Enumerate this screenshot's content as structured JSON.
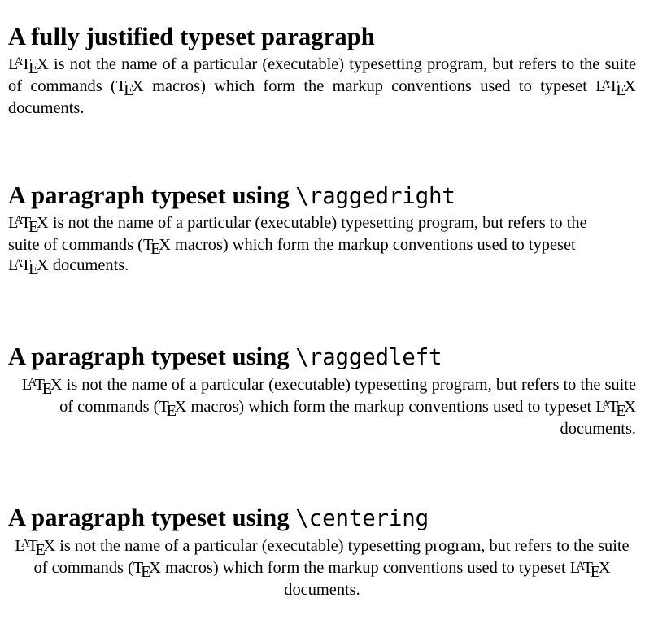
{
  "document": {
    "background_color": "#ffffff",
    "text_color": "#000000",
    "sections": [
      {
        "id": "fully-justified",
        "heading_text": "A fully justified typeset paragraph",
        "heading_plain_part": "A fully justified typeset paragraph",
        "heading_macro_part": "",
        "alignment": "justify",
        "paragraph_segments": {
          "s1": " is not the name of a particular (executable) typesetting program, but refers to the suite of commands (",
          "s2": " macros) which form the markup conventions used to typeset ",
          "s3": " documents."
        }
      },
      {
        "id": "raggedright",
        "heading_text": "A paragraph typeset using \\raggedright",
        "heading_plain_part": "A paragraph typeset using ",
        "heading_macro_part": "\\raggedright",
        "alignment": "raggedright",
        "paragraph_segments": {
          "s1": " is not the name of a particular (executable) typesetting program, but refers to the suite of commands (",
          "s2": " macros) which form the markup conventions used to typeset ",
          "s3": " documents."
        }
      },
      {
        "id": "raggedleft",
        "heading_text": "A paragraph typeset using \\raggedleft",
        "heading_plain_part": "A paragraph typeset using ",
        "heading_macro_part": "\\raggedleft",
        "alignment": "raggedleft",
        "paragraph_segments": {
          "s1": " is not the name of a particular (executable) typesetting program, but refers to the suite of commands (",
          "s2": " macros) which form the markup conventions used to typeset ",
          "s3": " documents."
        }
      },
      {
        "id": "centering",
        "heading_text": "A paragraph typeset using \\centering",
        "heading_plain_part": "A paragraph typeset using ",
        "heading_macro_part": "\\centering",
        "alignment": "centering",
        "paragraph_segments": {
          "s1": " is not the name of a particular (executable) typesetting program, but refers to the suite of commands (",
          "s2": " macros) which form the markup conventions used to typeset ",
          "s3": " documents."
        }
      }
    ],
    "logos": {
      "latex": {
        "l": "L",
        "a": "A",
        "t": "T",
        "e": "E",
        "x": "X"
      },
      "tex": {
        "t": "T",
        "e": "E",
        "x": "X"
      }
    }
  }
}
